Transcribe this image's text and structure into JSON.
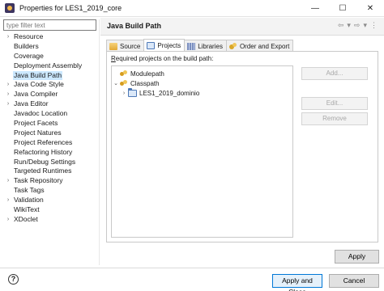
{
  "window": {
    "title": "Properties for LES1_2019_core",
    "minimize": "—",
    "maximize": "☐",
    "close": "✕"
  },
  "sidebar": {
    "filter_placeholder": "type filter text",
    "items": [
      {
        "label": "Resource",
        "expandable": true
      },
      {
        "label": "Builders",
        "expandable": false
      },
      {
        "label": "Coverage",
        "expandable": false
      },
      {
        "label": "Deployment Assembly",
        "expandable": false
      },
      {
        "label": "Java Build Path",
        "expandable": false,
        "selected": true
      },
      {
        "label": "Java Code Style",
        "expandable": true
      },
      {
        "label": "Java Compiler",
        "expandable": true
      },
      {
        "label": "Java Editor",
        "expandable": true
      },
      {
        "label": "Javadoc Location",
        "expandable": false
      },
      {
        "label": "Project Facets",
        "expandable": false
      },
      {
        "label": "Project Natures",
        "expandable": false
      },
      {
        "label": "Project References",
        "expandable": false
      },
      {
        "label": "Refactoring History",
        "expandable": false
      },
      {
        "label": "Run/Debug Settings",
        "expandable": false
      },
      {
        "label": "Targeted Runtimes",
        "expandable": false
      },
      {
        "label": "Task Repository",
        "expandable": true
      },
      {
        "label": "Task Tags",
        "expandable": false
      },
      {
        "label": "Validation",
        "expandable": true
      },
      {
        "label": "WikiText",
        "expandable": false
      },
      {
        "label": "XDoclet",
        "expandable": true
      }
    ]
  },
  "page": {
    "title": "Java Build Path",
    "nav": {
      "back": "⇦",
      "back_menu": "▾",
      "forward": "⇨",
      "forward_menu": "▾",
      "menu": "⋮"
    }
  },
  "tabs": [
    {
      "label": "Source",
      "icon": "source-folder-icon"
    },
    {
      "label": "Projects",
      "icon": "projects-icon",
      "active": true
    },
    {
      "label": "Libraries",
      "icon": "libraries-icon"
    },
    {
      "label": "Order and Export",
      "icon": "order-export-icon"
    }
  ],
  "projects": {
    "label": "Required projects on the build path:",
    "mnemonic": "R",
    "label_rest": "equired projects on the build path:",
    "tree": {
      "modulepath": "Modulepath",
      "classpath": "Classpath",
      "project": "LES1_2019_dominio"
    },
    "buttons": {
      "add": "Add...",
      "edit": "Edit...",
      "remove": "Remove"
    }
  },
  "footer": {
    "apply": "Apply",
    "apply_and_close": "Apply and Close",
    "cancel": "Cancel",
    "help": "?"
  }
}
